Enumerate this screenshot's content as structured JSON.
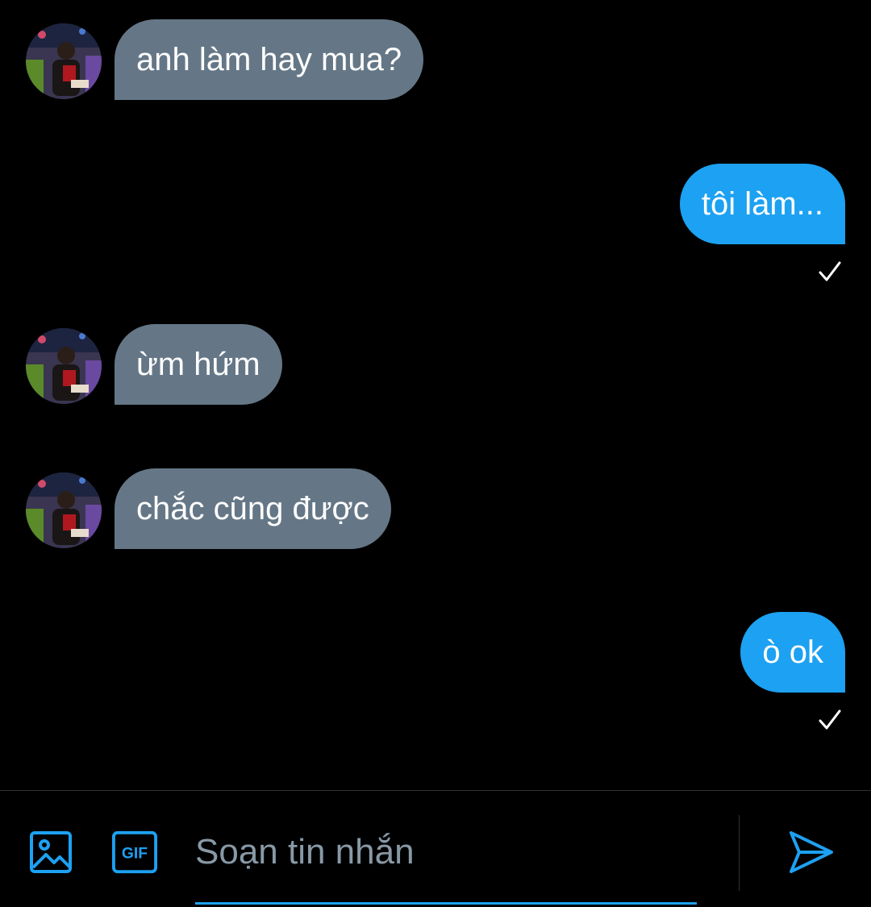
{
  "colors": {
    "background": "#000000",
    "incoming_bubble": "#657786",
    "outgoing_bubble": "#1da1f2",
    "accent": "#1da1f2",
    "placeholder": "#8899a6"
  },
  "messages": [
    {
      "direction": "incoming",
      "text": "anh làm hay mua?",
      "avatar": "contact-avatar"
    },
    {
      "direction": "outgoing",
      "text": "tôi làm...",
      "status_icon": "checkmark-icon"
    },
    {
      "direction": "incoming",
      "text": "ừm hứm",
      "avatar": "contact-avatar"
    },
    {
      "direction": "incoming",
      "text": "chắc cũng được",
      "avatar": "contact-avatar"
    },
    {
      "direction": "outgoing",
      "text": "ò ok",
      "status_icon": "checkmark-icon"
    }
  ],
  "composer": {
    "image_button_icon": "image-icon",
    "gif_button_icon": "gif-icon",
    "gif_label": "GIF",
    "input_value": "",
    "input_placeholder": "Soạn tin nhắn",
    "send_button_icon": "send-icon"
  }
}
